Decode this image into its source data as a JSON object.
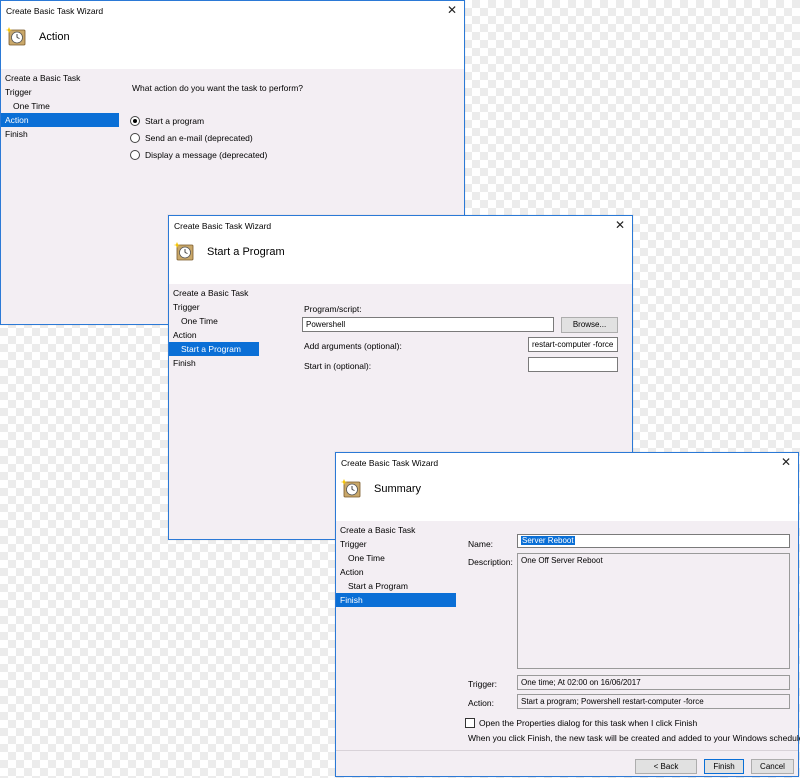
{
  "dialog1": {
    "window_title": "Create Basic Task Wizard",
    "header_title": "Action",
    "nav": [
      "Create a Basic Task",
      "Trigger",
      "One Time",
      "Action",
      "Finish"
    ],
    "question": "What action do you want the task to perform?",
    "options": [
      "Start a program",
      "Send an e-mail (deprecated)",
      "Display a message (deprecated)"
    ],
    "selected_option": 0
  },
  "dialog2": {
    "window_title": "Create Basic Task Wizard",
    "header_title": "Start a Program",
    "nav": [
      "Create a Basic Task",
      "Trigger",
      "One Time",
      "Action",
      "Start a Program",
      "Finish"
    ],
    "program_label": "Program/script:",
    "program_value": "Powershell",
    "browse_label": "Browse...",
    "args_label": "Add arguments (optional):",
    "args_value": "restart-computer -force",
    "startin_label": "Start in (optional):",
    "startin_value": ""
  },
  "dialog3": {
    "window_title": "Create Basic Task Wizard",
    "header_title": "Summary",
    "nav": [
      "Create a Basic Task",
      "Trigger",
      "One Time",
      "Action",
      "Start a Program",
      "Finish"
    ],
    "name_label": "Name:",
    "name_value": "Server Reboot",
    "description_label": "Description:",
    "description_value": "One Off Server Reboot",
    "trigger_label": "Trigger:",
    "trigger_value": "One time; At 02:00 on 16/06/2017",
    "action_label": "Action:",
    "action_value": "Start a program; Powershell restart-computer -force",
    "open_properties_label": "Open the Properties dialog for this task when I click Finish",
    "finish_note": "When you click Finish, the new task will be created and added to your Windows schedule.",
    "back_label": "< Back",
    "finish_label": "Finish",
    "cancel_label": "Cancel"
  },
  "icons": {
    "close": "close-icon",
    "task": "task-scheduler-clock-icon"
  },
  "colors": {
    "accent": "#0a6fd6",
    "border": "#2b79d6",
    "dialog_bg": "#f3eef3"
  }
}
